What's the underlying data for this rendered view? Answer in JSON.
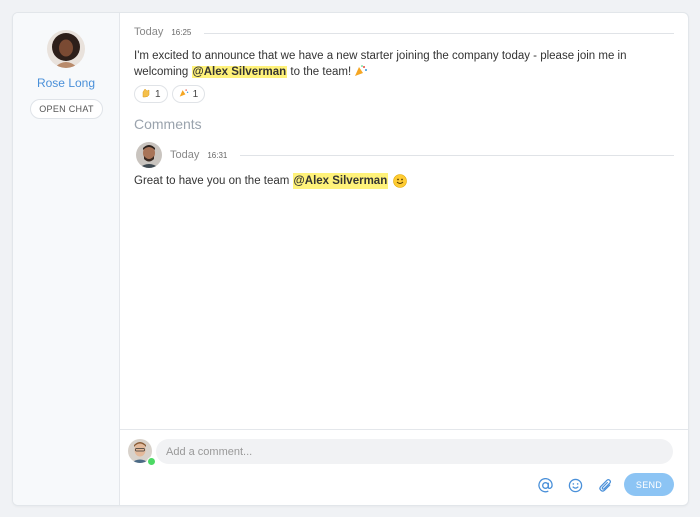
{
  "author": {
    "name": "Rose Long",
    "open_chat_label": "OPEN CHAT"
  },
  "post": {
    "day": "Today",
    "time": "16:25",
    "text_before": "I'm excited to announce that we have a new starter joining the company today - please join me in welcoming ",
    "mention": "@Alex Silverman",
    "text_after": " to the team!",
    "reactions": [
      {
        "icon": "clap-icon",
        "count": "1"
      },
      {
        "icon": "party-popper-icon",
        "count": "1"
      }
    ]
  },
  "comments": {
    "title": "Comments",
    "items": [
      {
        "day": "Today",
        "time": "16:31",
        "text_before": "Great to have you on the team ",
        "mention": "@Alex Silverman",
        "emoji": "smiley-icon"
      }
    ]
  },
  "composer": {
    "placeholder": "Add a comment...",
    "tools": [
      "at-mention-icon",
      "emoji-icon",
      "paperclip-icon"
    ],
    "send_label": "SEND"
  },
  "colors": {
    "accent": "#4a90d9",
    "mention_bg": "#fff27a",
    "send_bg": "#8cc4f4",
    "status_online": "#4cd964"
  }
}
